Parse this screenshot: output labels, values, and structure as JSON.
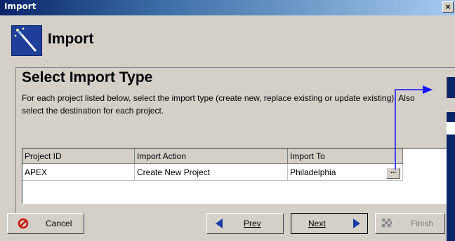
{
  "window": {
    "title": "Import",
    "close_glyph": "×"
  },
  "header": {
    "title": "Import",
    "icon": "magic-wand-icon"
  },
  "panel": {
    "title": "Select Import Type",
    "description": "For each project listed below, select the import type (create new, replace existing or update existing).  Also select the destination for each project."
  },
  "grid": {
    "columns": [
      "Project ID",
      "Import Action",
      "Import To"
    ],
    "rows": [
      {
        "project_id": "APEX",
        "import_action": "Create New Project",
        "import_to": "Philadelphia",
        "ellipsis": "..."
      }
    ]
  },
  "buttons": {
    "cancel": "Cancel",
    "prev": "Prev",
    "next": "Next",
    "finish": "Finish"
  },
  "colors": {
    "annotation_arrow": "#1010ff",
    "title_bar": "#0a246a",
    "cancel_icon": "#cc1100"
  }
}
